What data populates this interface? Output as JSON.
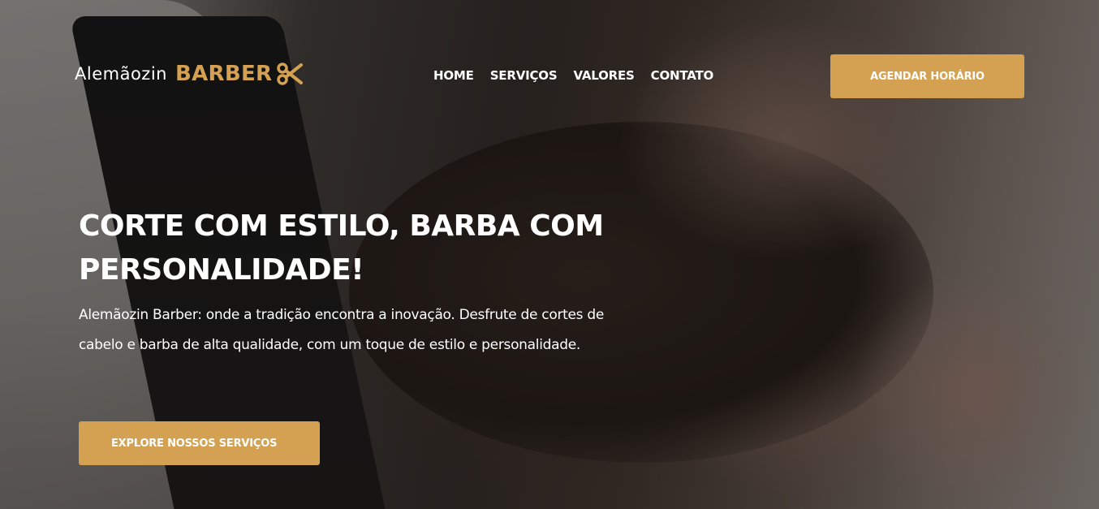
{
  "header": {
    "logo_name": "Alemãozin",
    "logo_brand": "BARBER",
    "logo_icon": "scissors-icon",
    "nav": [
      {
        "label": "HOME"
      },
      {
        "label": "SERVIÇOS"
      },
      {
        "label": "VALORES"
      },
      {
        "label": "CONTATO"
      }
    ],
    "cta_label": "AGENDAR HORÁRIO"
  },
  "hero": {
    "title": "CORTE COM ESTILO, BARBA COM PERSONALIDADE!",
    "description": "Alemãozin Barber: onde a tradição encontra a inovação. Desfrute de cortes de cabelo e barba de alta qualidade, com um toque de estilo e personalidade.",
    "button_label": "EXPLORE NOSSOS SERVIÇOS"
  },
  "colors": {
    "accent": "#d4a152",
    "text": "#ffffff"
  }
}
